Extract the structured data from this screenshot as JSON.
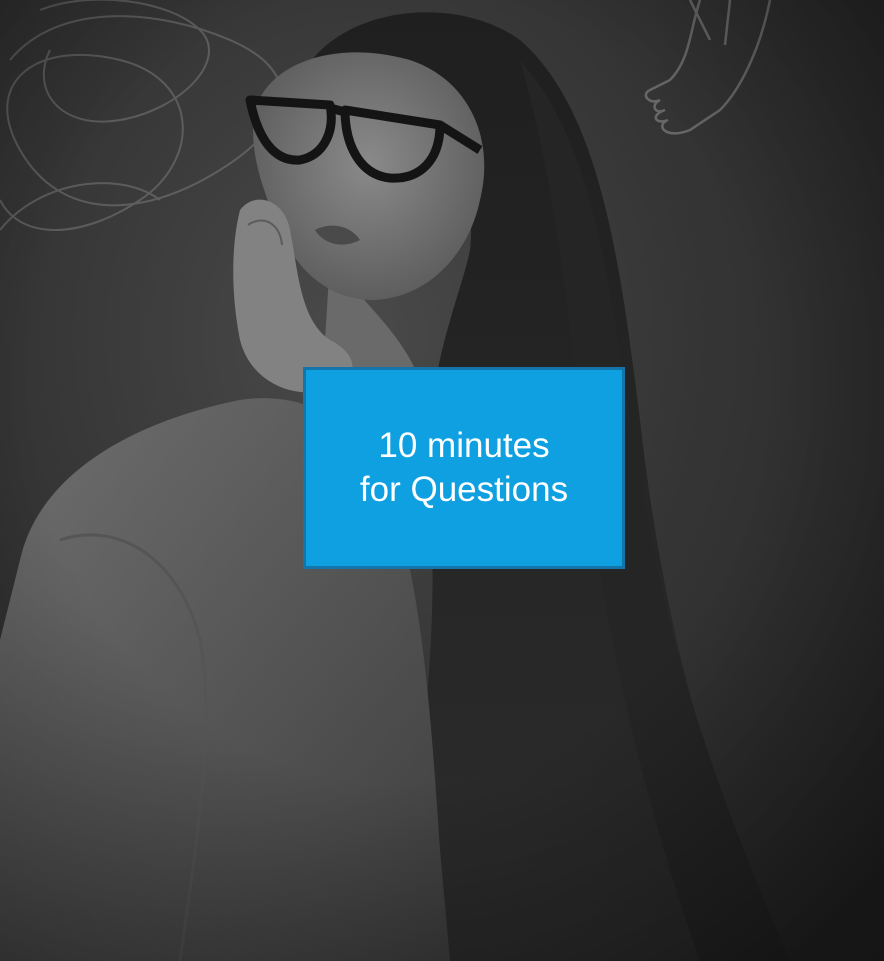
{
  "slide": {
    "callout": {
      "lines": [
        "10 minutes",
        "for Questions"
      ],
      "background_color": "#0ea0e0",
      "border_color": "#1276ad",
      "text_color": "#ffffff"
    },
    "background": {
      "description_icon": "thinking-woman-photo",
      "tone": "grayscale-dark"
    }
  }
}
